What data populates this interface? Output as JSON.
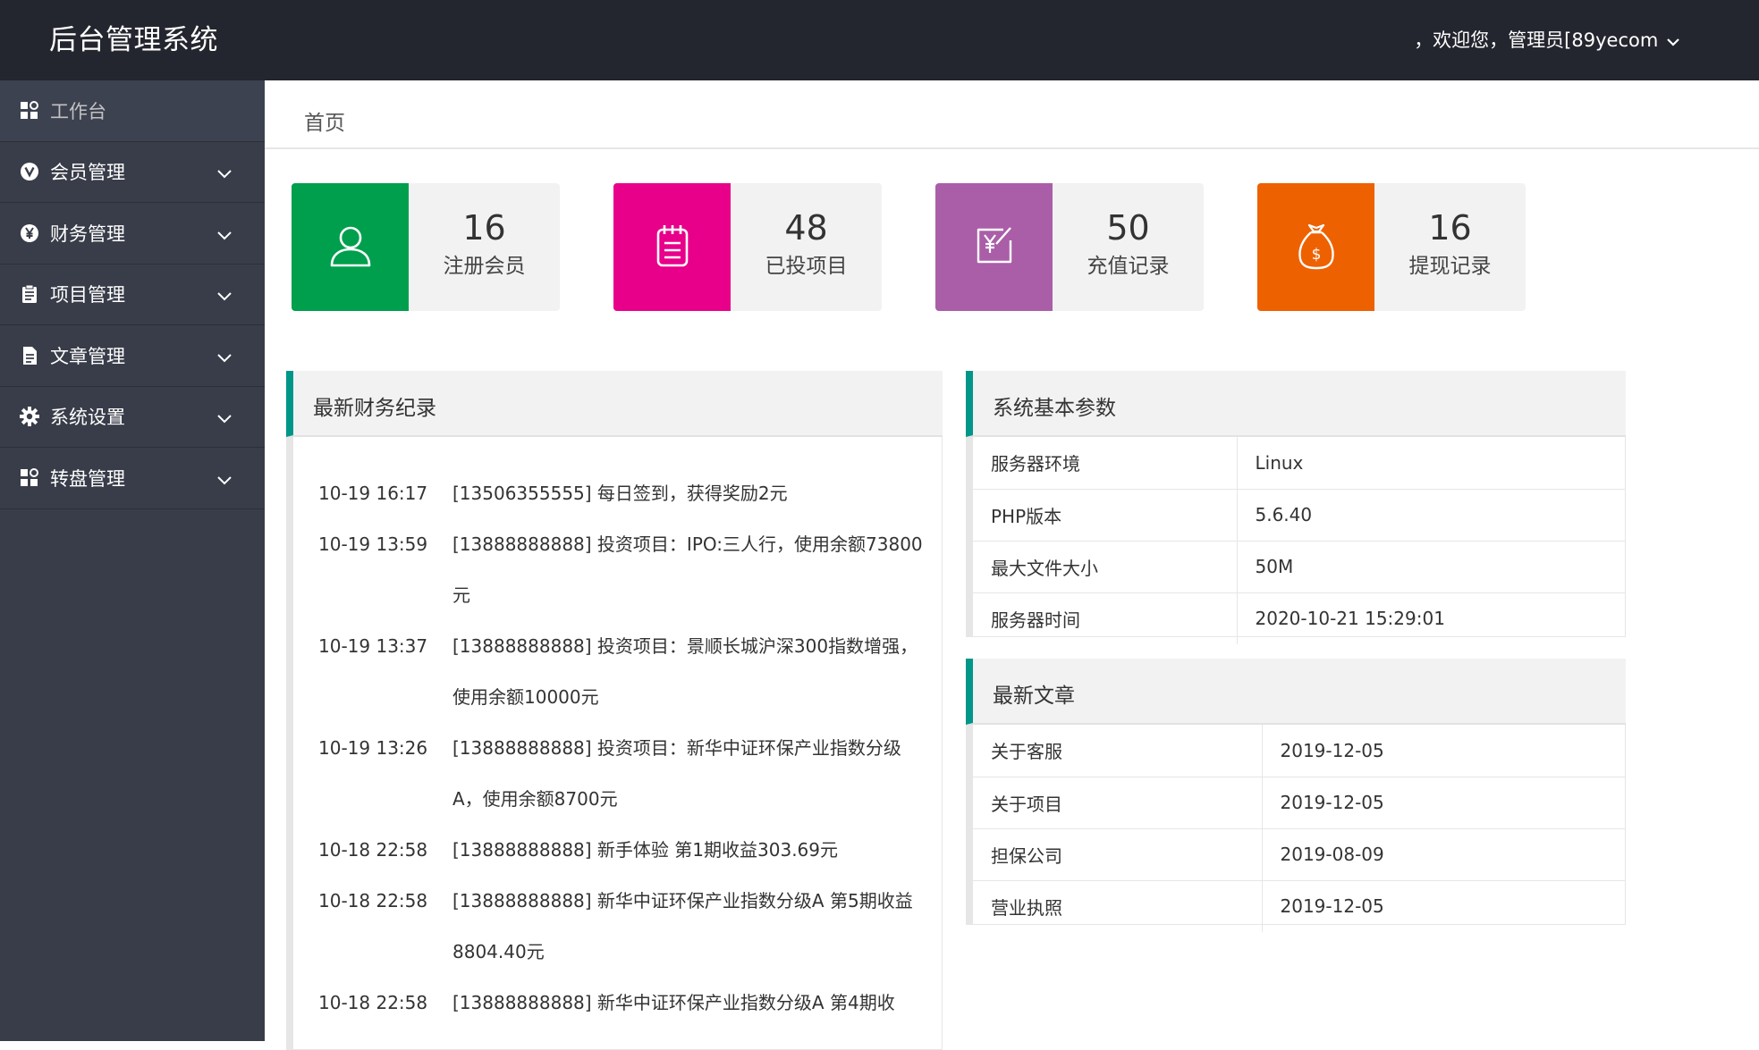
{
  "header": {
    "title": "后台管理系统",
    "welcome": "，欢迎您，管理员[89yecom"
  },
  "sidebar": {
    "items": [
      {
        "label": "工作台",
        "icon": "grid-icon"
      },
      {
        "label": "会员管理",
        "icon": "v-circle-icon"
      },
      {
        "label": "财务管理",
        "icon": "yen-circle-icon"
      },
      {
        "label": "项目管理",
        "icon": "clipboard-icon"
      },
      {
        "label": "文章管理",
        "icon": "document-icon"
      },
      {
        "label": "系统设置",
        "icon": "gear-icon"
      },
      {
        "label": "转盘管理",
        "icon": "grid-icon"
      }
    ]
  },
  "breadcrumb": "首页",
  "stats": [
    {
      "value": "16",
      "label": "注册会员",
      "color": "#009f4d",
      "icon": "user-icon"
    },
    {
      "value": "48",
      "label": "已投项目",
      "color": "#e8008a",
      "icon": "notepad-icon"
    },
    {
      "value": "50",
      "label": "充值记录",
      "color": "#aa5ea8",
      "icon": "yen-edit-icon"
    },
    {
      "value": "16",
      "label": "提现记录",
      "color": "#ee6100",
      "icon": "money-bag-icon"
    }
  ],
  "finance": {
    "title": "最新财务纪录",
    "rows": [
      {
        "time": "10-19 16:17",
        "text": "[13506355555] 每日签到，获得奖励2元"
      },
      {
        "time": "10-19 13:59",
        "text": "[13888888888] 投资项目：IPO:三人行，使用余额73800元"
      },
      {
        "time": "10-19 13:37",
        "text": "[13888888888] 投资项目：景顺长城沪深300指数增强，使用余额10000元"
      },
      {
        "time": "10-19 13:26",
        "text": "[13888888888] 投资项目：新华中证环保产业指数分级A，使用余额8700元"
      },
      {
        "time": "10-18 22:58",
        "text": "[13888888888] 新手体验 第1期收益303.69元"
      },
      {
        "time": "10-18 22:58",
        "text": "[13888888888] 新华中证环保产业指数分级A 第5期收益8804.40元"
      },
      {
        "time": "10-18 22:58",
        "text": "[13888888888] 新华中证环保产业指数分级A 第4期收"
      }
    ]
  },
  "system": {
    "title": "系统基本参数",
    "rows": [
      {
        "key": "服务器环境",
        "value": "Linux"
      },
      {
        "key": "PHP版本",
        "value": "5.6.40"
      },
      {
        "key": "最大文件大小",
        "value": "50M"
      },
      {
        "key": "服务器时间",
        "value": "2020-10-21 15:29:01"
      }
    ]
  },
  "articles": {
    "title": "最新文章",
    "rows": [
      {
        "key": "关于客服",
        "value": "2019-12-05"
      },
      {
        "key": "关于项目",
        "value": "2019-12-05"
      },
      {
        "key": "担保公司",
        "value": "2019-08-09"
      },
      {
        "key": "营业执照",
        "value": "2019-12-05"
      }
    ]
  },
  "colors": {
    "header_bg": "#24262f",
    "sidebar_bg": "#393d49",
    "accent": "#009688"
  }
}
